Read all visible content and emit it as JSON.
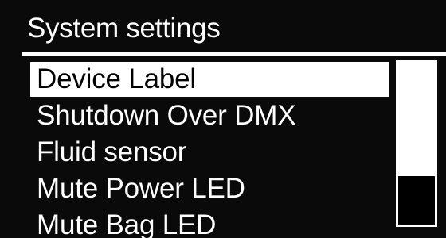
{
  "header": {
    "title": "System settings"
  },
  "menu": {
    "selected_index": 0,
    "items": [
      {
        "label": "Device Label"
      },
      {
        "label": "Shutdown Over DMX"
      },
      {
        "label": "Fluid sensor"
      },
      {
        "label": "Mute Power LED"
      },
      {
        "label": "Mute Bag LED"
      }
    ]
  },
  "scrollbar": {
    "visible_fraction": 0.7
  },
  "colors": {
    "background": "#000000",
    "foreground": "#ffffff",
    "highlight_text": "#000000"
  }
}
